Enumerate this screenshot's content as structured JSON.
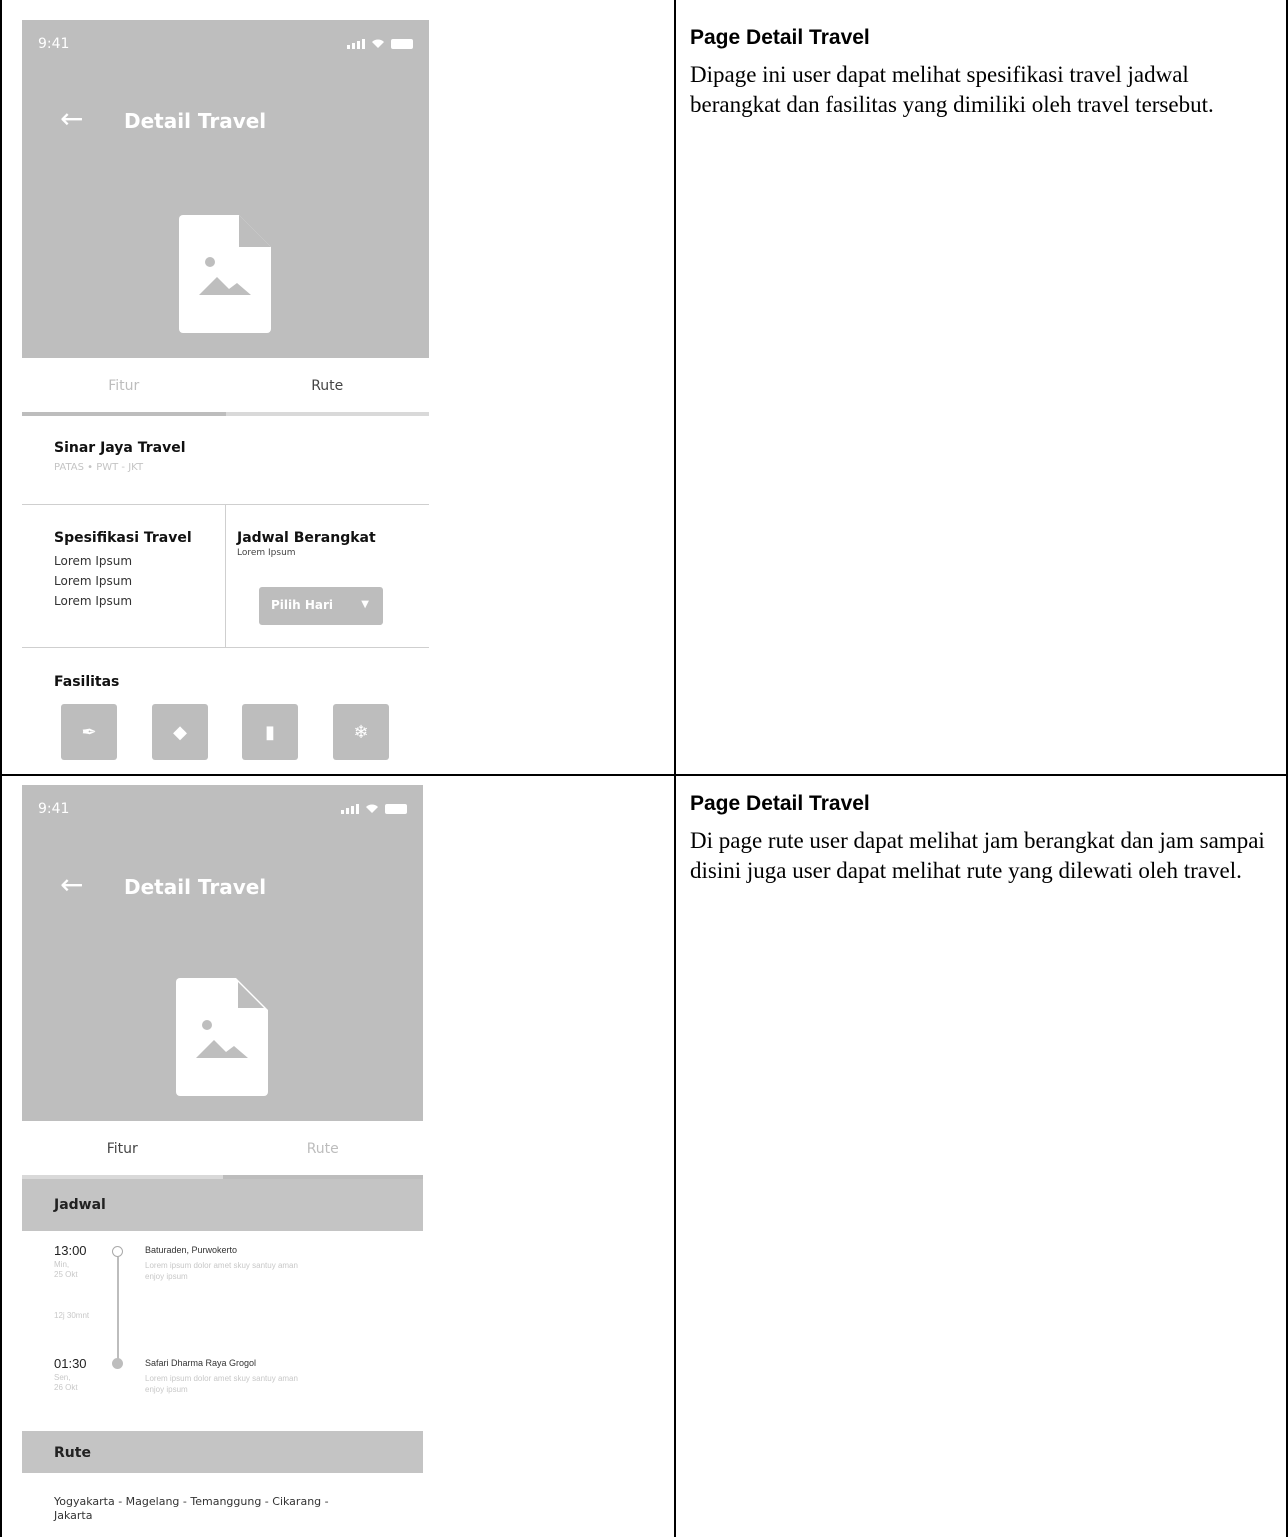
{
  "rows": [
    {
      "phone": {
        "status_time": "9:41",
        "header_title": "Detail Travel",
        "tabs": {
          "fitur": "Fitur",
          "rute": "Rute",
          "active": "fitur"
        },
        "operator_name": "Sinar Jaya Travel",
        "operator_sub": "PATAS • PWT - JKT",
        "spec_title": "Spesifikasi Travel",
        "spec_items": [
          "Lorem Ipsum",
          "Lorem Ipsum",
          "Lorem Ipsum"
        ],
        "schedule_title": "Jadwal Berangkat",
        "schedule_sub": "Lorem Ipsum",
        "day_select": "Pilih Hari",
        "facilities_title": "Fasilitas",
        "facility_icons": [
          "food-icon",
          "candy-icon",
          "drink-icon",
          "snowflake-icon"
        ]
      },
      "description": {
        "title": "Page Detail Travel",
        "body": "Dipage ini user dapat melihat spesifikasi travel jadwal berangkat dan fasilitas yang dimiliki oleh travel tersebut."
      }
    },
    {
      "phone": {
        "status_time": "9:41",
        "header_title": "Detail Travel",
        "tabs": {
          "fitur": "Fitur",
          "rute": "Rute",
          "active": "rute"
        },
        "schedule_header": "Jadwal",
        "departure": {
          "time": "13:00",
          "day": "Min,",
          "date": "25 Okt",
          "place": "Baturaden, Purwokerto",
          "desc": "Lorem ipsum dolor amet skuy santuy aman enjoy ipsum"
        },
        "duration": "12j 30mnt",
        "arrival": {
          "time": "01:30",
          "day": "Sen,",
          "date": "26 Okt",
          "place": "Safari Dharma Raya Grogol",
          "desc": "Lorem ipsum dolor amet skuy santuy aman enjoy ipsum"
        },
        "route_header": "Rute",
        "route_text": "Yogyakarta - Magelang - Temanggung - Cikarang - Jakarta"
      },
      "description": {
        "title": "Page Detail Travel",
        "body": "Di page rute user dapat melihat jam berangkat dan jam sampai disini juga user dapat melihat rute yang dilewati oleh travel."
      }
    }
  ]
}
